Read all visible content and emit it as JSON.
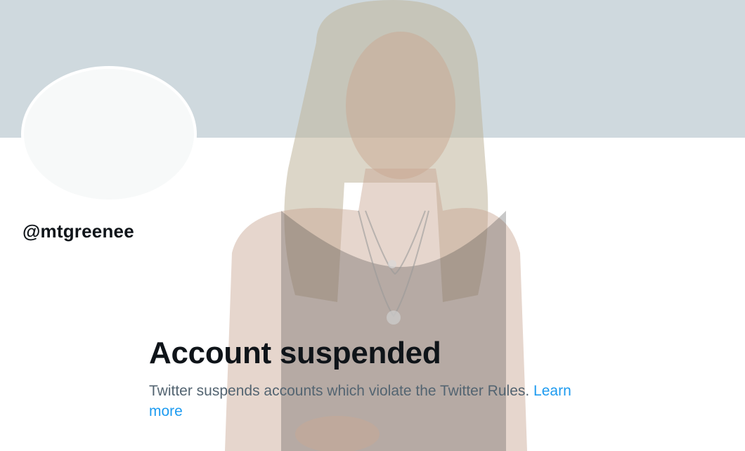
{
  "profile": {
    "handle": "@mtgreenee"
  },
  "notice": {
    "title": "Account suspended",
    "description": "Twitter suspends accounts which violate the Twitter Rules.",
    "link_label": "Learn more"
  },
  "colors": {
    "banner": "#cfd9de",
    "avatar_placeholder": "#f7f9f9",
    "title_text": "#0f1419",
    "body_text": "#536471",
    "link": "#1d9bf0"
  }
}
